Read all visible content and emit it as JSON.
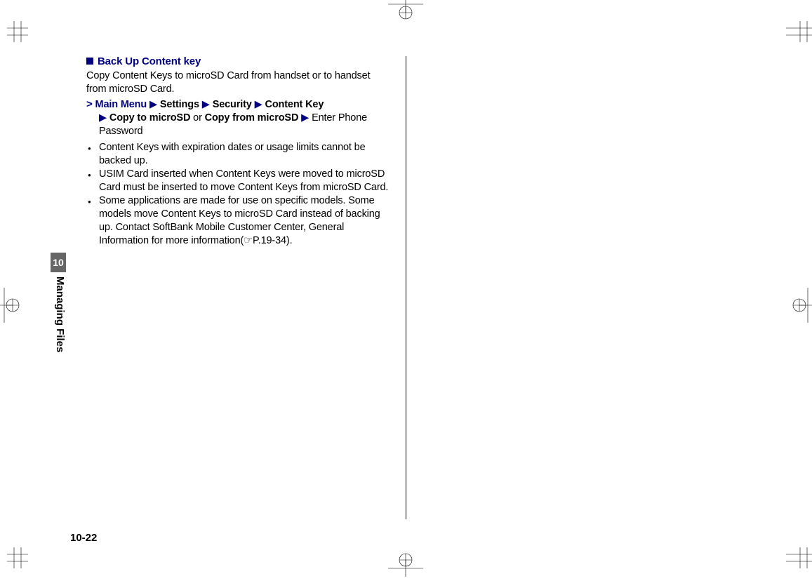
{
  "sidebar": {
    "chapter_number": "10",
    "chapter_title": "Managing Files"
  },
  "page_number": "10-22",
  "heading": "Back Up Content key",
  "intro": "Copy Content Keys to microSD Card from handset or to handset from microSD Card.",
  "nav": {
    "chevron": ">",
    "tri": "▶",
    "main_menu": "Main Menu",
    "settings": "Settings",
    "security": "Security",
    "content_key": "Content Key",
    "copy_to": "Copy to microSD",
    "or": "or",
    "copy_from": "Copy from microSD",
    "enter": "Enter Phone Password"
  },
  "notes": [
    "Content Keys with expiration dates or usage limits cannot be backed up.",
    "USIM Card inserted when Content Keys were moved to microSD Card must be inserted to move Content Keys from microSD Card.",
    "Some applications are made for use on specific models. Some models move Content Keys to microSD Card instead of backing up. Contact SoftBank Mobile Customer Center, General Information for more information(☞P.19-34)."
  ]
}
